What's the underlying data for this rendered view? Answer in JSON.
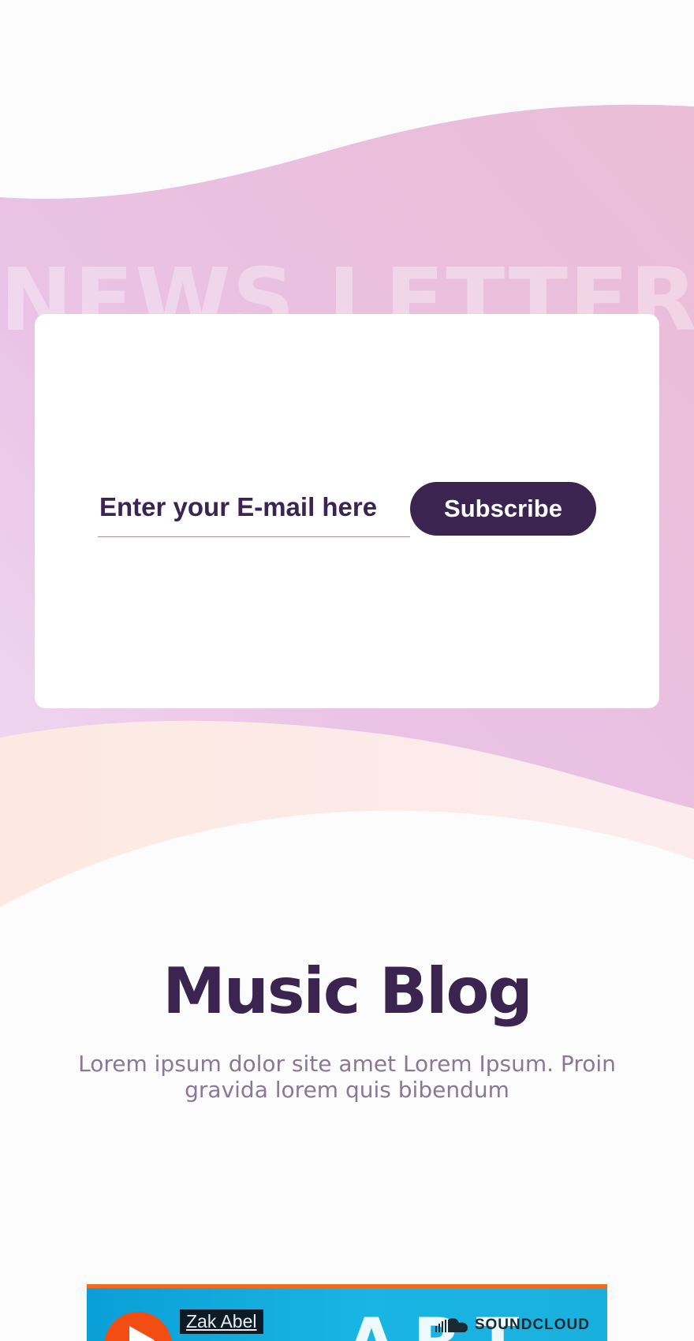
{
  "newsletter": {
    "watermark": "NEWS LETTER",
    "email_placeholder": "Enter your E-mail here",
    "subscribe_label": "Subscribe"
  },
  "blog": {
    "title": "Music Blog",
    "description": "Lorem ipsum dolor site amet Lorem Ipsum. Proin gravida lorem quis bibendum"
  },
  "embed": {
    "artist": "Zak Abel",
    "artwork_letters": "ART",
    "provider": "SOUNDCLOUD",
    "icons": [
      "play-icon",
      "soundcloud-icon"
    ]
  },
  "colors": {
    "primary": "#3b2450",
    "wave_pink": "#eac0de",
    "wave_peach": "#fdebe6",
    "accent_orange": "#f26a1b",
    "embed_blue": "#0a9fd6"
  }
}
